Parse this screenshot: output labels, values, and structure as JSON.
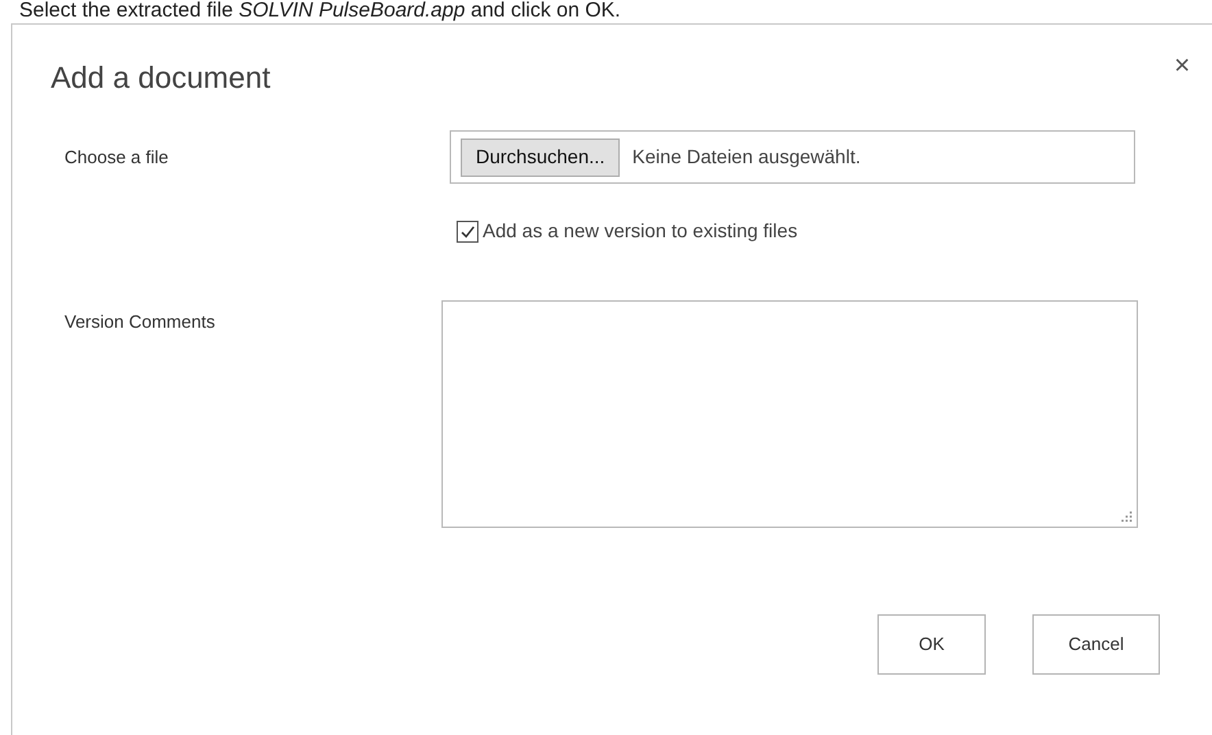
{
  "caption": "Select the extracted file *SOLVIN PulseBoard.app* and click on OK.",
  "dialog": {
    "title": "Add a document",
    "close": "×"
  },
  "file_field": {
    "label": "Choose a file",
    "button": "Durchsuchen...",
    "status": "Keine Dateien ausgewählt."
  },
  "version_checkbox": {
    "label": "Add as a new version to existing files",
    "checked": true
  },
  "comments_field": {
    "label": "Version Comments"
  },
  "buttons": [
    "OK",
    "Cancel"
  ]
}
